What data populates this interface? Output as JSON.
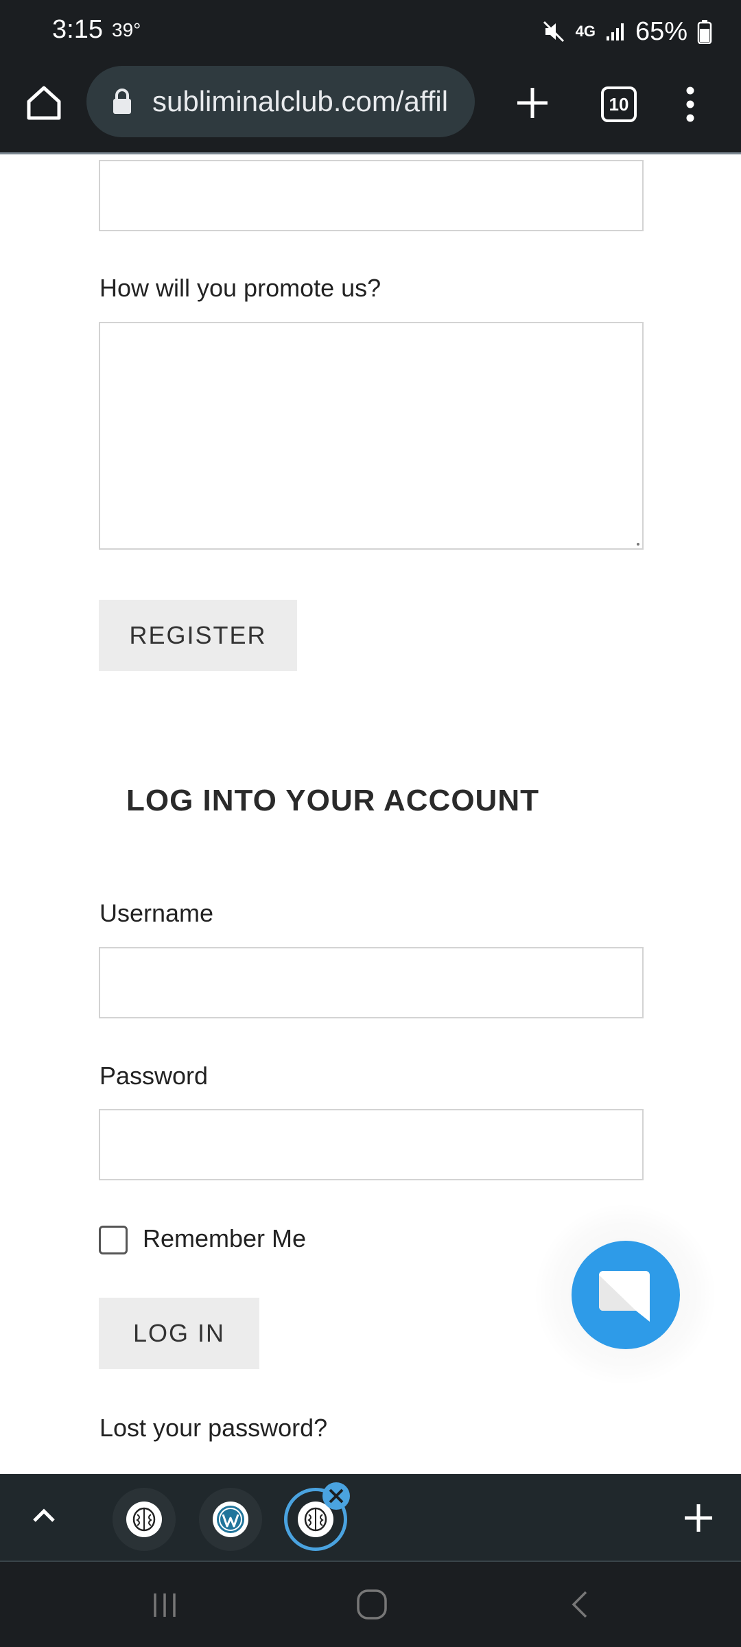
{
  "status_bar": {
    "time": "3:15",
    "temperature": "39°",
    "network": "4G",
    "battery": "65%",
    "icons": [
      "mute-icon",
      "signal-icon",
      "battery-icon"
    ]
  },
  "browser": {
    "url": "subliminalclub.com/affil",
    "tab_count": "10",
    "icons": [
      "home-icon",
      "lock-icon",
      "plus-icon",
      "tabs-icon",
      "more-vert-icon"
    ]
  },
  "form": {
    "promote_label": "How will you promote us?",
    "register_button": "REGISTER",
    "login_heading": "LOG INTO YOUR ACCOUNT",
    "username_label": "Username",
    "password_label": "Password",
    "remember_label": "Remember Me",
    "login_button": "LOG IN",
    "lost_password_link": "Lost your password?"
  },
  "tab_strip": {
    "tabs": [
      {
        "icon": "brain-icon",
        "active": false
      },
      {
        "icon": "wordpress-icon",
        "active": false
      },
      {
        "icon": "brain-icon",
        "active": true
      }
    ]
  },
  "colors": {
    "chrome_dark": "#1b1e21",
    "accent_blue": "#2e9be8",
    "button_gray": "#ececec"
  }
}
